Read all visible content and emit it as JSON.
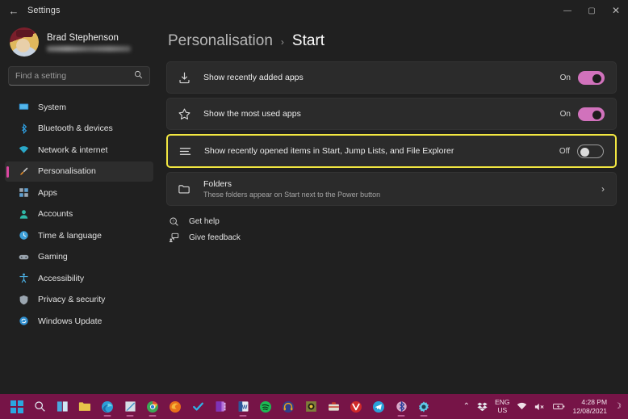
{
  "titlebar": {
    "back_icon": "←",
    "title": "Settings",
    "minimize": "—",
    "maximize": "▢",
    "close": "✕"
  },
  "sidebar": {
    "profile": {
      "name": "Brad Stephenson",
      "email_redacted": ""
    },
    "search": {
      "placeholder": "Find a setting",
      "value": "",
      "icon": "search-icon"
    },
    "items": [
      {
        "label": "System",
        "icon": "🖥",
        "active": false
      },
      {
        "label": "Bluetooth & devices",
        "icon": "🅑",
        "active": false
      },
      {
        "label": "Network & internet",
        "icon": "🌐",
        "active": false
      },
      {
        "label": "Personalisation",
        "icon": "🖌",
        "active": true
      },
      {
        "label": "Apps",
        "icon": "🗗",
        "active": false
      },
      {
        "label": "Accounts",
        "icon": "👤",
        "active": false
      },
      {
        "label": "Time & language",
        "icon": "🕐",
        "active": false
      },
      {
        "label": "Gaming",
        "icon": "🎮",
        "active": false
      },
      {
        "label": "Accessibility",
        "icon": "🧍",
        "active": false
      },
      {
        "label": "Privacy & security",
        "icon": "🛡",
        "active": false
      },
      {
        "label": "Windows Update",
        "icon": "🔄",
        "active": false
      }
    ]
  },
  "main": {
    "breadcrumb": {
      "parent": "Personalisation",
      "separator": "›",
      "current": "Start"
    },
    "rows": [
      {
        "icon": "download-icon",
        "glyph": "⤓",
        "title": "Show recently added apps",
        "state": "On",
        "toggle": "on",
        "highlighted": false
      },
      {
        "icon": "star-icon",
        "glyph": "☆",
        "title": "Show the most used apps",
        "state": "On",
        "toggle": "on",
        "highlighted": false
      },
      {
        "icon": "list-icon",
        "glyph": "☰",
        "title": "Show recently opened items in Start, Jump Lists, and File Explorer",
        "state": "Off",
        "toggle": "off",
        "highlighted": true
      }
    ],
    "folders_row": {
      "icon": "folder-icon",
      "glyph": "🗀",
      "title": "Folders",
      "subtitle": "These folders appear on Start next to the Power button",
      "chevron": "›"
    },
    "links": [
      {
        "label": "Get help",
        "icon": "help-icon",
        "glyph": "？"
      },
      {
        "label": "Give feedback",
        "icon": "feedback-icon",
        "glyph": "🗨"
      }
    ]
  },
  "taskbar": {
    "apps": [
      {
        "name": "start-button",
        "glyph": "",
        "color": "#2aa7e0",
        "running": false
      },
      {
        "name": "search-taskbar",
        "glyph": "🔍",
        "color": "#cfe7f5",
        "running": false
      },
      {
        "name": "widgets-button",
        "glyph": "▥",
        "color": "#3da9e0",
        "running": false
      },
      {
        "name": "file-explorer",
        "glyph": "🗂",
        "color": "#e8c34a",
        "running": false
      },
      {
        "name": "microsoft-edge",
        "glyph": "◉",
        "color": "#37a0d8",
        "running": true
      },
      {
        "name": "onenote-app",
        "glyph": "🪶",
        "color": "#cfd8e4",
        "running": true
      },
      {
        "name": "google-chrome",
        "glyph": "◎",
        "color": "#3ba756",
        "running": true
      },
      {
        "name": "mozilla-firefox",
        "glyph": "◐",
        "color": "#e8701a",
        "running": false
      },
      {
        "name": "todoist-app",
        "glyph": "✔",
        "color": "#2fb4e8",
        "running": false
      },
      {
        "name": "onenote-purple",
        "glyph": "▤",
        "color": "#9a4fc4",
        "running": false
      },
      {
        "name": "microsoft-word",
        "glyph": "W",
        "color": "#2b579a",
        "running": true
      },
      {
        "name": "spotify-app",
        "glyph": "♫",
        "color": "#1db954",
        "running": false
      },
      {
        "name": "audio-app",
        "glyph": "🎧",
        "color": "#e0a020",
        "running": false
      },
      {
        "name": "camera-app",
        "glyph": "◉",
        "color": "#8c8c3a",
        "running": false
      },
      {
        "name": "toolbox-app",
        "glyph": "🧰",
        "color": "#d8d8c8",
        "running": false
      },
      {
        "name": "vivaldi-browser",
        "glyph": "V",
        "color": "#cf2a2a",
        "running": false
      },
      {
        "name": "telegram-app",
        "glyph": "➤",
        "color": "#29a1d8",
        "running": false
      },
      {
        "name": "bluetooth-app",
        "glyph": "⚡",
        "color": "#3a6fd8",
        "running": true
      },
      {
        "name": "settings-app",
        "glyph": "⚙",
        "color": "#5fc8e8",
        "running": true
      }
    ],
    "tray": {
      "chevron": "⌃",
      "dropbox_icon": "❖",
      "language_line1": "ENG",
      "language_line2": "US",
      "wifi_icon": "▲",
      "volume_icon": "🔇",
      "battery_icon": "🔋",
      "time": "4:28 PM",
      "date": "12/08/2021",
      "notification_icon": "☽"
    }
  },
  "colors": {
    "accent_pink": "#d172bc",
    "selection_pink": "#d946a0",
    "highlight_yellow": "#f2e741",
    "taskbar": "#761447",
    "window_bg": "#202020",
    "card_bg": "#2b2b2b"
  }
}
